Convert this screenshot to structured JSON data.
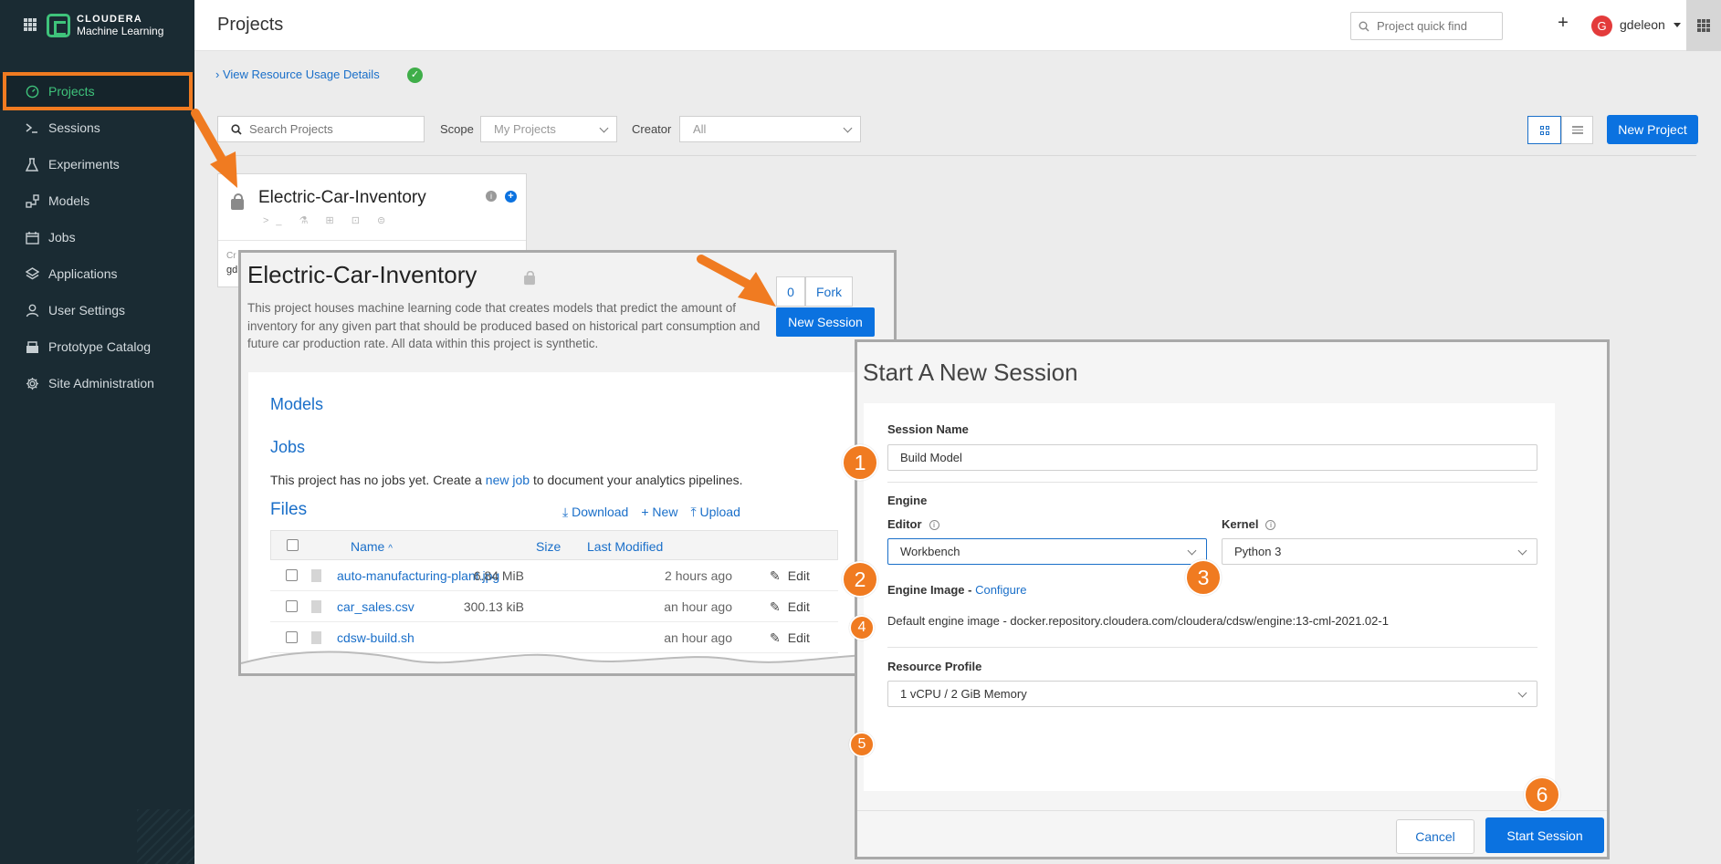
{
  "sidebar": {
    "brand_line1": "CLOUDERA",
    "brand_line2": "Machine Learning",
    "items": [
      {
        "label": "Projects",
        "icon": "gauge-icon"
      },
      {
        "label": "Sessions",
        "icon": "terminal-icon"
      },
      {
        "label": "Experiments",
        "icon": "flask-icon"
      },
      {
        "label": "Models",
        "icon": "models-icon"
      },
      {
        "label": "Jobs",
        "icon": "calendar-icon"
      },
      {
        "label": "Applications",
        "icon": "layers-icon"
      },
      {
        "label": "User Settings",
        "icon": "user-icon"
      },
      {
        "label": "Prototype Catalog",
        "icon": "catalog-icon"
      },
      {
        "label": "Site Administration",
        "icon": "gear-icon"
      }
    ]
  },
  "header": {
    "title": "Projects",
    "quick_find_placeholder": "Project quick find",
    "user_initial": "G",
    "username": "gdeleon"
  },
  "toolbar": {
    "resource_link": "View Resource Usage Details",
    "search_placeholder": "Search Projects",
    "scope_label": "Scope",
    "scope_value": "My Projects",
    "creator_label": "Creator",
    "creator_value": "All",
    "new_project_label": "New Project"
  },
  "project_card": {
    "title": "Electric-Car-Inventory",
    "icons": ">_ ⚗ ⊞ ⊡ ⊜",
    "footer_line1": "Cr",
    "footer_line2": "gd"
  },
  "overview": {
    "title": "Electric-Car-Inventory",
    "description": "This project houses machine learning code that creates models that predict the amount of inventory for any given part that should be produced based on historical part consumption and future car production rate. All data within this project is synthetic.",
    "star_count": "0",
    "fork_label": "Fork",
    "new_session_label": "New Session",
    "models_heading": "Models",
    "jobs_heading": "Jobs",
    "jobs_text_before": "This project has no jobs yet. Create a ",
    "jobs_link": "new job",
    "jobs_text_after": " to document your analytics pipelines.",
    "files_heading": "Files",
    "download_label": "Download",
    "new_label": "New",
    "upload_label": "Upload",
    "columns": {
      "name": "Name",
      "size": "Size",
      "modified": "Last Modified"
    },
    "files": [
      {
        "name": "auto-manufacturing-plant.jpg",
        "size": "6.84 MiB",
        "modified": "2 hours ago",
        "action": "Edit"
      },
      {
        "name": "car_sales.csv",
        "size": "300.13 kiB",
        "modified": "an hour ago",
        "action": "Edit"
      },
      {
        "name": "cdsw-build.sh",
        "size": "",
        "modified": "an hour ago",
        "action": "Edit"
      }
    ]
  },
  "session_modal": {
    "title": "Start A New Session",
    "session_name_label": "Session Name",
    "session_name_value": "Build Model",
    "engine_heading": "Engine",
    "editor_label": "Editor",
    "editor_value": "Workbench",
    "kernel_label": "Kernel",
    "kernel_value": "Python 3",
    "engine_image_label": "Engine Image - ",
    "configure_link": "Configure",
    "engine_image_text": "Default engine image - docker.repository.cloudera.com/cloudera/cdsw/engine:13-cml-2021.02-1",
    "resource_profile_label": "Resource Profile",
    "resource_profile_value": "1 vCPU / 2 GiB Memory",
    "cancel_label": "Cancel",
    "start_label": "Start Session"
  },
  "badges": [
    "1",
    "2",
    "3",
    "4",
    "5",
    "6"
  ],
  "colors": {
    "sidebar_bg": "#1a2b33",
    "accent_green": "#3fc37b",
    "primary_blue": "#0b72e0",
    "annotation_orange": "#f07b21"
  }
}
